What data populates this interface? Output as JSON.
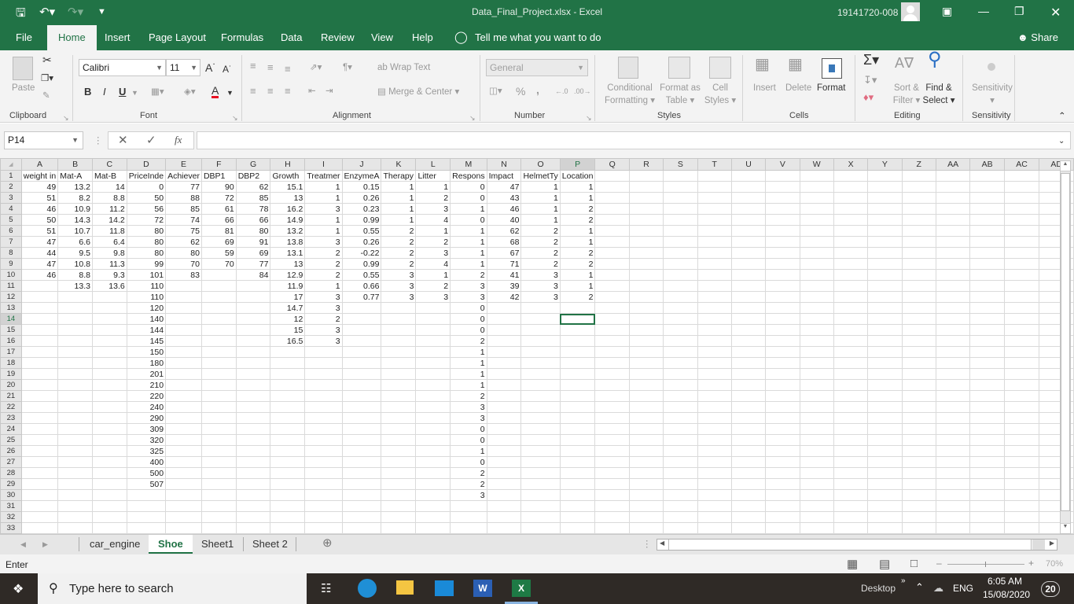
{
  "app": {
    "title": "Data_Final_Project.xlsx  -  Excel",
    "user_id": "19141720-008",
    "qat": {
      "save": "save-icon",
      "undo": "undo-icon",
      "redo": "redo-icon",
      "customize": "customize-icon"
    }
  },
  "tabs": [
    "File",
    "Home",
    "Insert",
    "Page Layout",
    "Formulas",
    "Data",
    "Review",
    "View",
    "Help"
  ],
  "active_tab": "Home",
  "tell_me": "Tell me what you want to do",
  "share": "Share",
  "ribbon": {
    "clipboard": {
      "label": "Clipboard",
      "paste": "Paste"
    },
    "font": {
      "label": "Font",
      "name": "Calibri",
      "size": "11",
      "bold": "B",
      "italic": "I",
      "underline": "U",
      "color": "#e81123"
    },
    "alignment": {
      "label": "Alignment",
      "wrap_text": "Wrap Text",
      "merge_center": "Merge & Center"
    },
    "number": {
      "label": "Number",
      "format": "General",
      "percent": "%",
      "comma": ","
    },
    "styles": {
      "label": "Styles",
      "conditional": [
        "Conditional",
        "Formatting"
      ],
      "format_table": [
        "Format as",
        "Table"
      ],
      "cell_styles": [
        "Cell",
        "Styles"
      ]
    },
    "cells": {
      "label": "Cells",
      "insert": "Insert",
      "delete": "Delete",
      "format": "Format"
    },
    "editing": {
      "label": "Editing",
      "sort_filter": [
        "Sort &",
        "Filter"
      ],
      "find_select": [
        "Find &",
        "Select"
      ]
    },
    "sensitivity": {
      "label": "Sensitivity",
      "button": "Sensitivity"
    }
  },
  "formula_bar": {
    "name_box": "P14",
    "formula": "",
    "fx": "fx"
  },
  "grid": {
    "columns": [
      "A",
      "B",
      "C",
      "D",
      "E",
      "F",
      "G",
      "H",
      "I",
      "J",
      "K",
      "L",
      "M",
      "N",
      "O",
      "P",
      "Q",
      "R",
      "S",
      "T",
      "U",
      "V",
      "W",
      "X",
      "Y",
      "Z",
      "AA",
      "AB",
      "AC",
      "AD"
    ],
    "rows": [
      [
        "weight in",
        "Mat-A",
        "Mat-B",
        "PriceInde",
        "Achiever",
        "DBP1",
        "DBP2",
        "Growth",
        "Treatmer",
        "EnzymeA",
        "Therapy",
        "Litter",
        "Respons",
        "Impact",
        "HelmetTy",
        "Location"
      ],
      [
        "49",
        "13.2",
        "14",
        "0",
        "77",
        "90",
        "62",
        "15.1",
        "1",
        "0.15",
        "1",
        "1",
        "0",
        "47",
        "1",
        "1"
      ],
      [
        "51",
        "8.2",
        "8.8",
        "50",
        "88",
        "72",
        "85",
        "13",
        "1",
        "0.26",
        "1",
        "2",
        "0",
        "43",
        "1",
        "1"
      ],
      [
        "46",
        "10.9",
        "11.2",
        "56",
        "85",
        "61",
        "78",
        "16.2",
        "3",
        "0.23",
        "1",
        "3",
        "1",
        "46",
        "1",
        "2"
      ],
      [
        "50",
        "14.3",
        "14.2",
        "72",
        "74",
        "66",
        "66",
        "14.9",
        "1",
        "0.99",
        "1",
        "4",
        "0",
        "40",
        "1",
        "2"
      ],
      [
        "51",
        "10.7",
        "11.8",
        "80",
        "75",
        "81",
        "80",
        "13.2",
        "1",
        "0.55",
        "2",
        "1",
        "1",
        "62",
        "2",
        "1"
      ],
      [
        "47",
        "6.6",
        "6.4",
        "80",
        "62",
        "69",
        "91",
        "13.8",
        "3",
        "0.26",
        "2",
        "2",
        "1",
        "68",
        "2",
        "1"
      ],
      [
        "44",
        "9.5",
        "9.8",
        "80",
        "80",
        "59",
        "69",
        "13.1",
        "2",
        "-0.22",
        "2",
        "3",
        "1",
        "67",
        "2",
        "2"
      ],
      [
        "47",
        "10.8",
        "11.3",
        "99",
        "70",
        "70",
        "77",
        "13",
        "2",
        "0.99",
        "2",
        "4",
        "1",
        "71",
        "2",
        "2"
      ],
      [
        "46",
        "8.8",
        "9.3",
        "101",
        "83",
        "",
        "84",
        "12.9",
        "2",
        "0.55",
        "3",
        "1",
        "2",
        "41",
        "3",
        "1"
      ],
      [
        "",
        "13.3",
        "13.6",
        "110",
        "",
        "",
        "",
        "11.9",
        "1",
        "0.66",
        "3",
        "2",
        "3",
        "39",
        "3",
        "1"
      ],
      [
        "",
        "",
        "",
        "110",
        "",
        "",
        "",
        "17",
        "3",
        "0.77",
        "3",
        "3",
        "3",
        "42",
        "3",
        "2"
      ],
      [
        "",
        "",
        "",
        "120",
        "",
        "",
        "",
        "14.7",
        "3",
        "",
        "",
        "",
        "0",
        "",
        "",
        ""
      ],
      [
        "",
        "",
        "",
        "140",
        "",
        "",
        "",
        "12",
        "2",
        "",
        "",
        "",
        "0",
        "",
        "",
        ""
      ],
      [
        "",
        "",
        "",
        "144",
        "",
        "",
        "",
        "15",
        "3",
        "",
        "",
        "",
        "0",
        "",
        "",
        ""
      ],
      [
        "",
        "",
        "",
        "145",
        "",
        "",
        "",
        "16.5",
        "3",
        "",
        "",
        "",
        "2",
        "",
        "",
        ""
      ],
      [
        "",
        "",
        "",
        "150",
        "",
        "",
        "",
        "",
        "",
        "",
        "",
        "",
        "1",
        "",
        "",
        ""
      ],
      [
        "",
        "",
        "",
        "180",
        "",
        "",
        "",
        "",
        "",
        "",
        "",
        "",
        "1",
        "",
        "",
        ""
      ],
      [
        "",
        "",
        "",
        "201",
        "",
        "",
        "",
        "",
        "",
        "",
        "",
        "",
        "1",
        "",
        "",
        ""
      ],
      [
        "",
        "",
        "",
        "210",
        "",
        "",
        "",
        "",
        "",
        "",
        "",
        "",
        "1",
        "",
        "",
        ""
      ],
      [
        "",
        "",
        "",
        "220",
        "",
        "",
        "",
        "",
        "",
        "",
        "",
        "",
        "2",
        "",
        "",
        ""
      ],
      [
        "",
        "",
        "",
        "240",
        "",
        "",
        "",
        "",
        "",
        "",
        "",
        "",
        "3",
        "",
        "",
        ""
      ],
      [
        "",
        "",
        "",
        "290",
        "",
        "",
        "",
        "",
        "",
        "",
        "",
        "",
        "3",
        "",
        "",
        ""
      ],
      [
        "",
        "",
        "",
        "309",
        "",
        "",
        "",
        "",
        "",
        "",
        "",
        "",
        "0",
        "",
        "",
        ""
      ],
      [
        "",
        "",
        "",
        "320",
        "",
        "",
        "",
        "",
        "",
        "",
        "",
        "",
        "0",
        "",
        "",
        ""
      ],
      [
        "",
        "",
        "",
        "325",
        "",
        "",
        "",
        "",
        "",
        "",
        "",
        "",
        "1",
        "",
        "",
        ""
      ],
      [
        "",
        "",
        "",
        "400",
        "",
        "",
        "",
        "",
        "",
        "",
        "",
        "",
        "0",
        "",
        "",
        ""
      ],
      [
        "",
        "",
        "",
        "500",
        "",
        "",
        "",
        "",
        "",
        "",
        "",
        "",
        "2",
        "",
        "",
        ""
      ],
      [
        "",
        "",
        "",
        "507",
        "",
        "",
        "",
        "",
        "",
        "",
        "",
        "",
        "2",
        "",
        "",
        ""
      ],
      [
        "",
        "",
        "",
        "",
        "",
        "",
        "",
        "",
        "",
        "",
        "",
        "",
        "3",
        "",
        "",
        ""
      ],
      [
        "",
        "",
        "",
        "",
        "",
        "",
        "",
        "",
        "",
        "",
        "",
        "",
        "",
        "",
        "",
        ""
      ],
      [
        "",
        "",
        "",
        "",
        "",
        "",
        "",
        "",
        "",
        "",
        "",
        "",
        "",
        "",
        "",
        ""
      ],
      [
        "",
        "",
        "",
        "",
        "",
        "",
        "",
        "",
        "",
        "",
        "",
        "",
        "",
        "",
        "",
        ""
      ]
    ]
  },
  "sheets": [
    "car_engine",
    "Shoe",
    "Sheet1",
    "Sheet 2"
  ],
  "active_sheet": "Shoe",
  "status": {
    "mode": "Enter",
    "zoom": "70%"
  },
  "taskbar": {
    "search_placeholder": "Type here to search",
    "desktop": "Desktop",
    "lang": "ENG",
    "time": "6:05 AM",
    "date": "15/08/2020",
    "notifications": "20"
  }
}
